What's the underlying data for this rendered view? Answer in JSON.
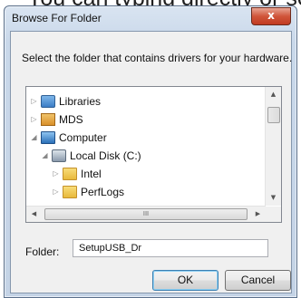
{
  "background": {
    "text": "You can typing directly or se"
  },
  "window": {
    "title": "Browse For Folder",
    "close_glyph": "x"
  },
  "dialog": {
    "instruction": "Select the folder that contains drivers for your hardware.",
    "tree": [
      {
        "label": "Libraries",
        "expander": "collapsed",
        "icon": "libraries-icon"
      },
      {
        "label": "MDS",
        "expander": "collapsed",
        "icon": "user-folder-icon"
      },
      {
        "label": "Computer",
        "expander": "expanded",
        "icon": "computer-icon"
      },
      {
        "label": "Local Disk (C:)",
        "expander": "expanded",
        "icon": "disk-drive-icon"
      },
      {
        "label": "Intel",
        "expander": "collapsed",
        "icon": "folder-icon"
      },
      {
        "label": "PerfLogs",
        "expander": "collapsed",
        "icon": "folder-icon"
      }
    ],
    "scrollbar": {
      "up": "▲",
      "down": "▼",
      "left": "◀",
      "right": "▶",
      "grip": "III"
    },
    "folder_label": "Folder:",
    "folder_value": "SetupUSB_Dr",
    "ok_label": "OK",
    "cancel_label": "Cancel"
  },
  "glyphs": {
    "collapsed": "▷",
    "expanded": "◢"
  }
}
